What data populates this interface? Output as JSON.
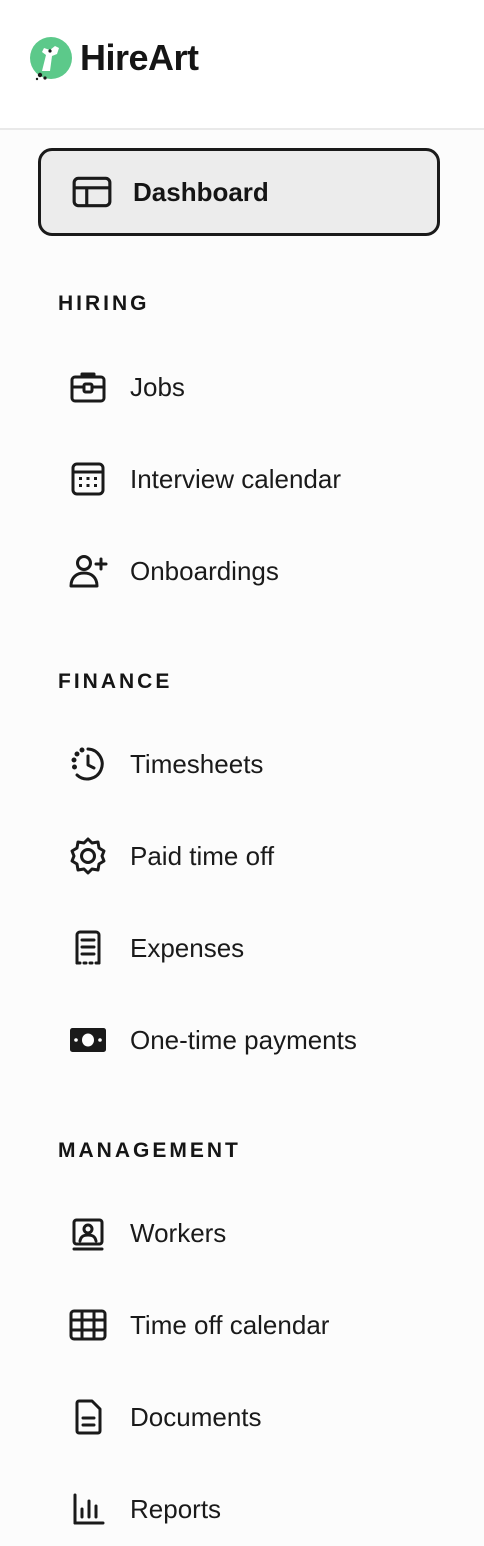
{
  "brand": {
    "name": "HireArt",
    "accent_color": "#5cc98a"
  },
  "nav": {
    "dashboard": {
      "label": "Dashboard",
      "icon": "layout-icon",
      "active": true
    },
    "sections": [
      {
        "title": "HIRING",
        "items": [
          {
            "label": "Jobs",
            "icon": "briefcase-icon"
          },
          {
            "label": "Interview calendar",
            "icon": "calendar-icon"
          },
          {
            "label": "Onboardings",
            "icon": "user-plus-icon"
          }
        ]
      },
      {
        "title": "FINANCE",
        "items": [
          {
            "label": "Timesheets",
            "icon": "clock-icon"
          },
          {
            "label": "Paid time off",
            "icon": "gear-icon"
          },
          {
            "label": "Expenses",
            "icon": "receipt-icon"
          },
          {
            "label": "One-time payments",
            "icon": "cash-icon"
          }
        ]
      },
      {
        "title": "MANAGEMENT",
        "items": [
          {
            "label": "Workers",
            "icon": "id-badge-icon"
          },
          {
            "label": "Time off calendar",
            "icon": "grid-calendar-icon"
          },
          {
            "label": "Documents",
            "icon": "document-icon"
          },
          {
            "label": "Reports",
            "icon": "bar-chart-icon"
          }
        ]
      }
    ]
  }
}
